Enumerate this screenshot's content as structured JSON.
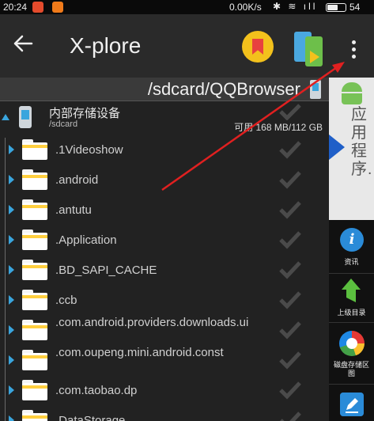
{
  "status_bar": {
    "time": "20:24",
    "network_speed": "0.00K/s",
    "glyphs": "✱ ≋ ıll",
    "battery_level": 0.54,
    "battery_text": "54"
  },
  "app_bar": {
    "title": "X-plore",
    "back_icon": "arrow-left-icon",
    "bookmark_icon": "bookmark-icon",
    "switch_icon": "switch-panel-icon",
    "menu_icon": "overflow-menu-icon"
  },
  "path_bar": {
    "path": "/sdcard/QQBrowser"
  },
  "storage": {
    "name": "内部存储设备",
    "mount": "/sdcard",
    "free_label": "可用",
    "free_value": "168 MB/112 GB"
  },
  "files": [
    {
      "name": ".1Videoshow"
    },
    {
      "name": ".android"
    },
    {
      "name": ".antutu"
    },
    {
      "name": ".Application"
    },
    {
      "name": ".BD_SAPI_CACHE"
    },
    {
      "name": ".ccb"
    },
    {
      "name": ".com.android.providers.downloads.ui"
    },
    {
      "name": ".com.oupeng.mini.android.const"
    },
    {
      "name": ".com.taobao.dp"
    },
    {
      "name": ".DataStorage"
    }
  ],
  "side_panel": {
    "app_label": "应用程序…",
    "tools": [
      {
        "label": "资讯",
        "icon": "info-icon"
      },
      {
        "label": "上级目录",
        "icon": "up-arrow-icon"
      },
      {
        "label": "磁盘存储区图",
        "icon": "disk-map-icon"
      },
      {
        "label": "",
        "icon": "edit-icon"
      }
    ]
  },
  "colors": {
    "accent_blue": "#3aa5dd",
    "folder_yellow": "#ffcf3f",
    "annotation_red": "#e02020"
  }
}
